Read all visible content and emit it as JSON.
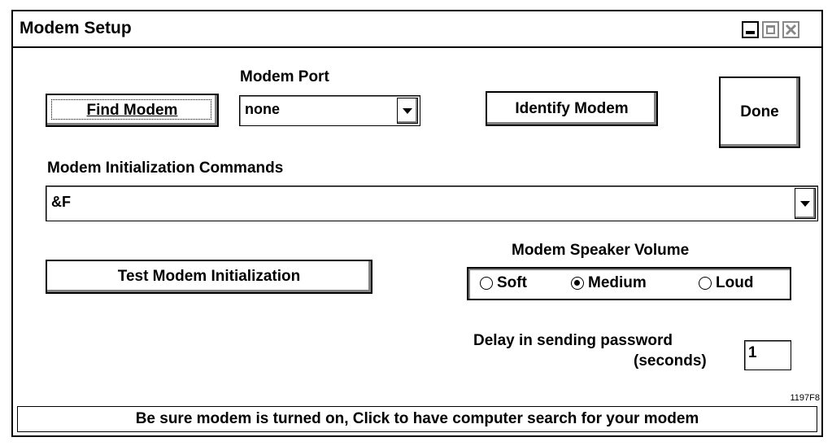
{
  "window": {
    "title": "Modem Setup"
  },
  "buttons": {
    "find_modem": "Find Modem",
    "identify_modem": "Identify Modem",
    "done": "Done",
    "test_init": "Test Modem Initialization"
  },
  "modem_port": {
    "label": "Modem Port",
    "value": "none"
  },
  "init_commands": {
    "label": "Modem Initialization Commands",
    "value": "&F"
  },
  "speaker_volume": {
    "label": "Modem Speaker Volume",
    "options": [
      "Soft",
      "Medium",
      "Loud"
    ],
    "selected": "Medium"
  },
  "delay": {
    "label_line1": "Delay in sending password",
    "label_line2": "(seconds)",
    "value": "1"
  },
  "status": "Be sure modem is turned on, Click to have computer search for your modem",
  "figure_id": "1197F8"
}
